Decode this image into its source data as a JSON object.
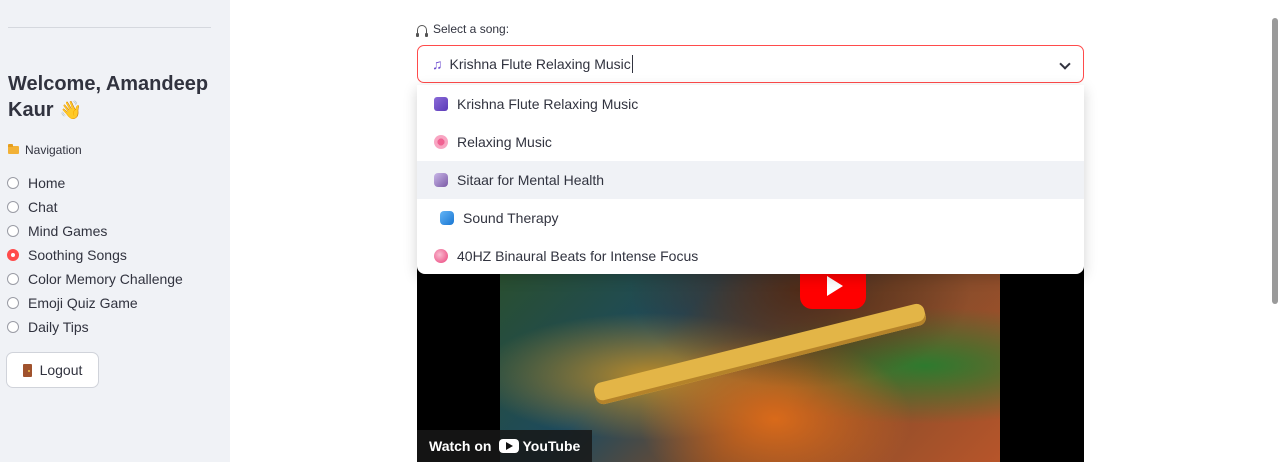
{
  "sidebar": {
    "welcome": "Welcome, Amandeep Kaur",
    "nav_title": "Navigation",
    "items": [
      {
        "label": "Home",
        "selected": false
      },
      {
        "label": "Chat",
        "selected": false
      },
      {
        "label": "Mind Games",
        "selected": false
      },
      {
        "label": "Soothing Songs",
        "selected": true
      },
      {
        "label": "Color Memory Challenge",
        "selected": false
      },
      {
        "label": "Emoji Quiz Game",
        "selected": false
      },
      {
        "label": "Daily Tips",
        "selected": false
      }
    ],
    "logout_label": "Logout"
  },
  "main": {
    "select_label": "Select a song:",
    "select_value": "Krishna Flute Relaxing Music",
    "options": [
      {
        "label": "Krishna Flute Relaxing Music",
        "icon": "music-note-icon"
      },
      {
        "label": "Relaxing Music",
        "icon": "flower-icon"
      },
      {
        "label": "Sitaar for Mental Health",
        "icon": "violin-icon",
        "highlighted": true
      },
      {
        "label": "Sound Therapy",
        "icon": "wave-icon"
      },
      {
        "label": "40HZ Binaural Beats for Intense Focus",
        "icon": "brain-icon"
      }
    ],
    "video": {
      "watch_on": "Watch on",
      "youtube": "YouTube"
    }
  },
  "colors": {
    "accent": "#ff4b4b",
    "sidebar_bg": "#f0f2f6",
    "text": "#31333f"
  }
}
